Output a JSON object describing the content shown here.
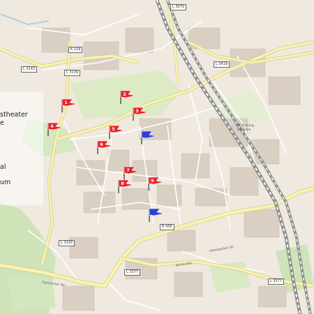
{
  "overlay": {
    "lines": [
      "stheater",
      "e",
      "al",
      "um"
    ]
  },
  "road_labels": [
    "L 3079",
    "L 3143",
    "L 3139",
    "K 118",
    "L 3419",
    "B 458",
    "L 3143",
    "L 3377",
    "L 3377"
  ],
  "area_labels": [
    "DB Training",
    "DB Bank",
    "Karlstraße",
    "Frankfurter Str.",
    "Heimbacher Str."
  ],
  "markers": [
    {
      "label": "1",
      "color": "red"
    },
    {
      "label": "2",
      "color": "red"
    },
    {
      "label": "3",
      "color": "red"
    },
    {
      "label": "4",
      "color": "red"
    },
    {
      "label": "5",
      "color": "red"
    },
    {
      "label": "6",
      "color": "red"
    },
    {
      "label": "7",
      "color": "red"
    },
    {
      "label": "8",
      "color": "red"
    },
    {
      "label": "9",
      "color": "red"
    },
    {
      "label": "",
      "color": "blue"
    },
    {
      "label": "",
      "color": "blue"
    }
  ],
  "colors": {
    "flag_red": "#e8222a",
    "flag_blue": "#2f3fd6",
    "road_yellow": "#f7f4b0",
    "park_green": "#cfe3b8",
    "railway_gray": "#9a9a9a"
  }
}
